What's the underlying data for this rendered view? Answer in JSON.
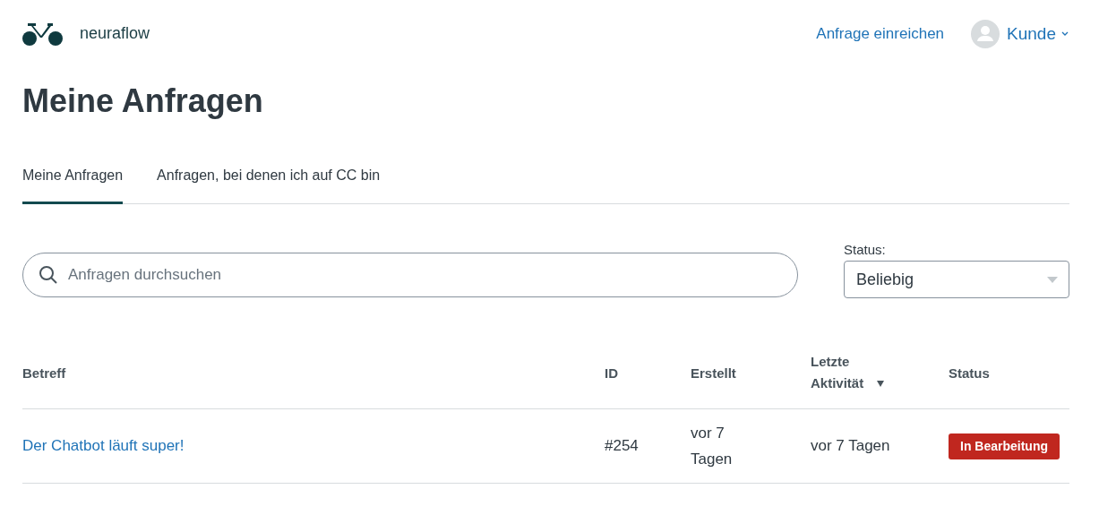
{
  "header": {
    "brand": "neuraflow",
    "links": [
      {
        "label": "Anfrage einreichen"
      }
    ],
    "user": {
      "name": "Kunde"
    }
  },
  "page_title": "Meine Anfragen",
  "tabs": [
    {
      "label": "Meine Anfragen",
      "selected": true
    },
    {
      "label": "Anfragen, bei denen ich auf CC bin",
      "selected": false
    }
  ],
  "search": {
    "placeholder": "Anfragen durchsuchen"
  },
  "status_filter": {
    "label": "Status:",
    "value": "Beliebig"
  },
  "table": {
    "columns": [
      {
        "label": "Betreff",
        "sorted": false
      },
      {
        "label": "ID",
        "sorted": false
      },
      {
        "label": "Erstellt",
        "sorted": false
      },
      {
        "label": "Letzte Aktivität",
        "sorted": true
      },
      {
        "label": "Status",
        "sorted": false
      }
    ],
    "rows": [
      {
        "subject": "Der Chatbot läuft super!",
        "id": "#254",
        "created": "vor 7 Tagen",
        "last_activity": "vor 7 Tagen",
        "status": {
          "label": "In Bearbeitung",
          "color": "#c0271f"
        }
      }
    ]
  }
}
